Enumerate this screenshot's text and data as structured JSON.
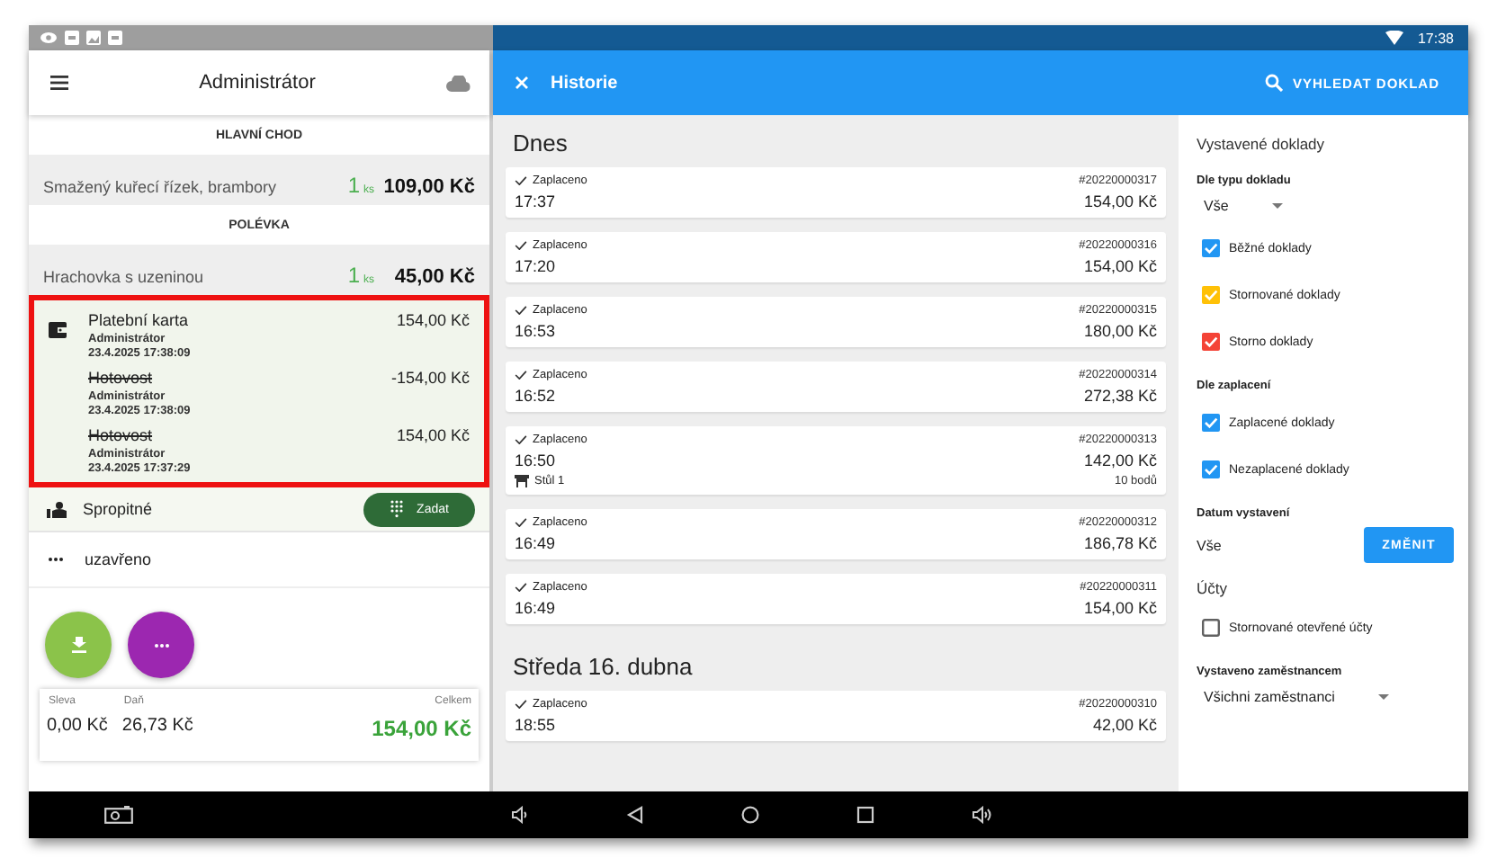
{
  "status_bar": {
    "time": "17:38"
  },
  "left": {
    "title": "Administrátor",
    "sections": [
      {
        "header": "HLAVNÍ CHOD",
        "items": [
          {
            "name": "Smažený kuřecí řízek, brambory",
            "qty": "1",
            "unit": "ks",
            "price": "109,00 Kč"
          }
        ]
      },
      {
        "header": "POLÉVKA",
        "items": [
          {
            "name": "Hrachovka s uzeninou",
            "qty": "1",
            "unit": "ks",
            "price": "45,00 Kč"
          }
        ]
      }
    ],
    "payments": {
      "highlighted": true,
      "entries": [
        {
          "kind": "card",
          "method": "Platební karta",
          "user": "Administrátor",
          "datetime": "23.4.2025 17:38:09",
          "amount": "154,00 Kč",
          "struck": false
        },
        {
          "kind": "cash",
          "method": "Hotovost",
          "user": "Administrátor",
          "datetime": "23.4.2025 17:38:09",
          "amount": "-154,00 Kč",
          "struck": true
        },
        {
          "kind": "cash",
          "method": "Hotovost",
          "user": "Administrátor",
          "datetime": "23.4.2025 17:37:29",
          "amount": "154,00 Kč",
          "struck": true
        }
      ]
    },
    "tip": {
      "label": "Spropitné",
      "button": "Zadat"
    },
    "state": {
      "label": "uzavřeno"
    },
    "totals": [
      {
        "kind": "plain",
        "label": "Sleva",
        "value": "0,00 Kč"
      },
      {
        "kind": "plain",
        "label": "Daň",
        "value": "26,73 Kč"
      },
      {
        "kind": "total",
        "label": "Celkem",
        "value": "154,00 Kč"
      }
    ]
  },
  "history": {
    "title": "Historie",
    "search": "VYHLEDAT DOKLAD",
    "groups": [
      {
        "heading": "Dnes",
        "receipts": [
          {
            "status": "Zaplaceno",
            "number": "#20220000317",
            "time": "17:37",
            "amount": "154,00 Kč"
          },
          {
            "status": "Zaplaceno",
            "number": "#20220000316",
            "time": "17:20",
            "amount": "154,00 Kč"
          },
          {
            "status": "Zaplaceno",
            "number": "#20220000315",
            "time": "16:53",
            "amount": "180,00 Kč"
          },
          {
            "status": "Zaplaceno",
            "number": "#20220000314",
            "time": "16:52",
            "amount": "272,38 Kč"
          },
          {
            "status": "Zaplaceno",
            "number": "#20220000313",
            "time": "16:50",
            "amount": "142,00 Kč",
            "table": "Stůl 1",
            "points": "10 bodů"
          },
          {
            "status": "Zaplaceno",
            "number": "#20220000312",
            "time": "16:49",
            "amount": "186,78 Kč"
          },
          {
            "status": "Zaplaceno",
            "number": "#20220000311",
            "time": "16:49",
            "amount": "154,00 Kč"
          }
        ]
      },
      {
        "heading": "Středa 16. dubna",
        "receipts": [
          {
            "status": "Zaplaceno",
            "number": "#20220000310",
            "time": "18:55",
            "amount": "42,00 Kč"
          }
        ]
      }
    ]
  },
  "filters": [
    {
      "kind": "title",
      "text": "Vystavené doklady"
    },
    {
      "kind": "label",
      "text": "Dle typu dokladu"
    },
    {
      "kind": "dropdown",
      "text": "Vše"
    },
    {
      "kind": "checkbox",
      "text": "Běžné doklady",
      "checked": true,
      "color": "#2196f3"
    },
    {
      "kind": "checkbox",
      "text": "Stornované doklady",
      "checked": true,
      "color": "#ffc107"
    },
    {
      "kind": "checkbox",
      "text": "Storno doklady",
      "checked": true,
      "color": "#f44336"
    },
    {
      "kind": "label",
      "text": "Dle zaplacení"
    },
    {
      "kind": "checkbox",
      "text": "Zaplacené doklady",
      "checked": true,
      "color": "#2196f3"
    },
    {
      "kind": "checkbox",
      "text": "Nezaplacené doklady",
      "checked": true,
      "color": "#2196f3"
    },
    {
      "kind": "label",
      "text": "Datum vystavení"
    },
    {
      "kind": "value_button",
      "text": "Vše",
      "button": "ZMĚNIT"
    },
    {
      "kind": "title",
      "text": "Účty"
    },
    {
      "kind": "checkbox",
      "text": "Stornované otevřené účty",
      "checked": false,
      "color": "#616161"
    },
    {
      "kind": "label",
      "text": "Vystaveno zaměstnancem"
    },
    {
      "kind": "dropdown",
      "text": "Všichni zaměstnanci"
    }
  ]
}
